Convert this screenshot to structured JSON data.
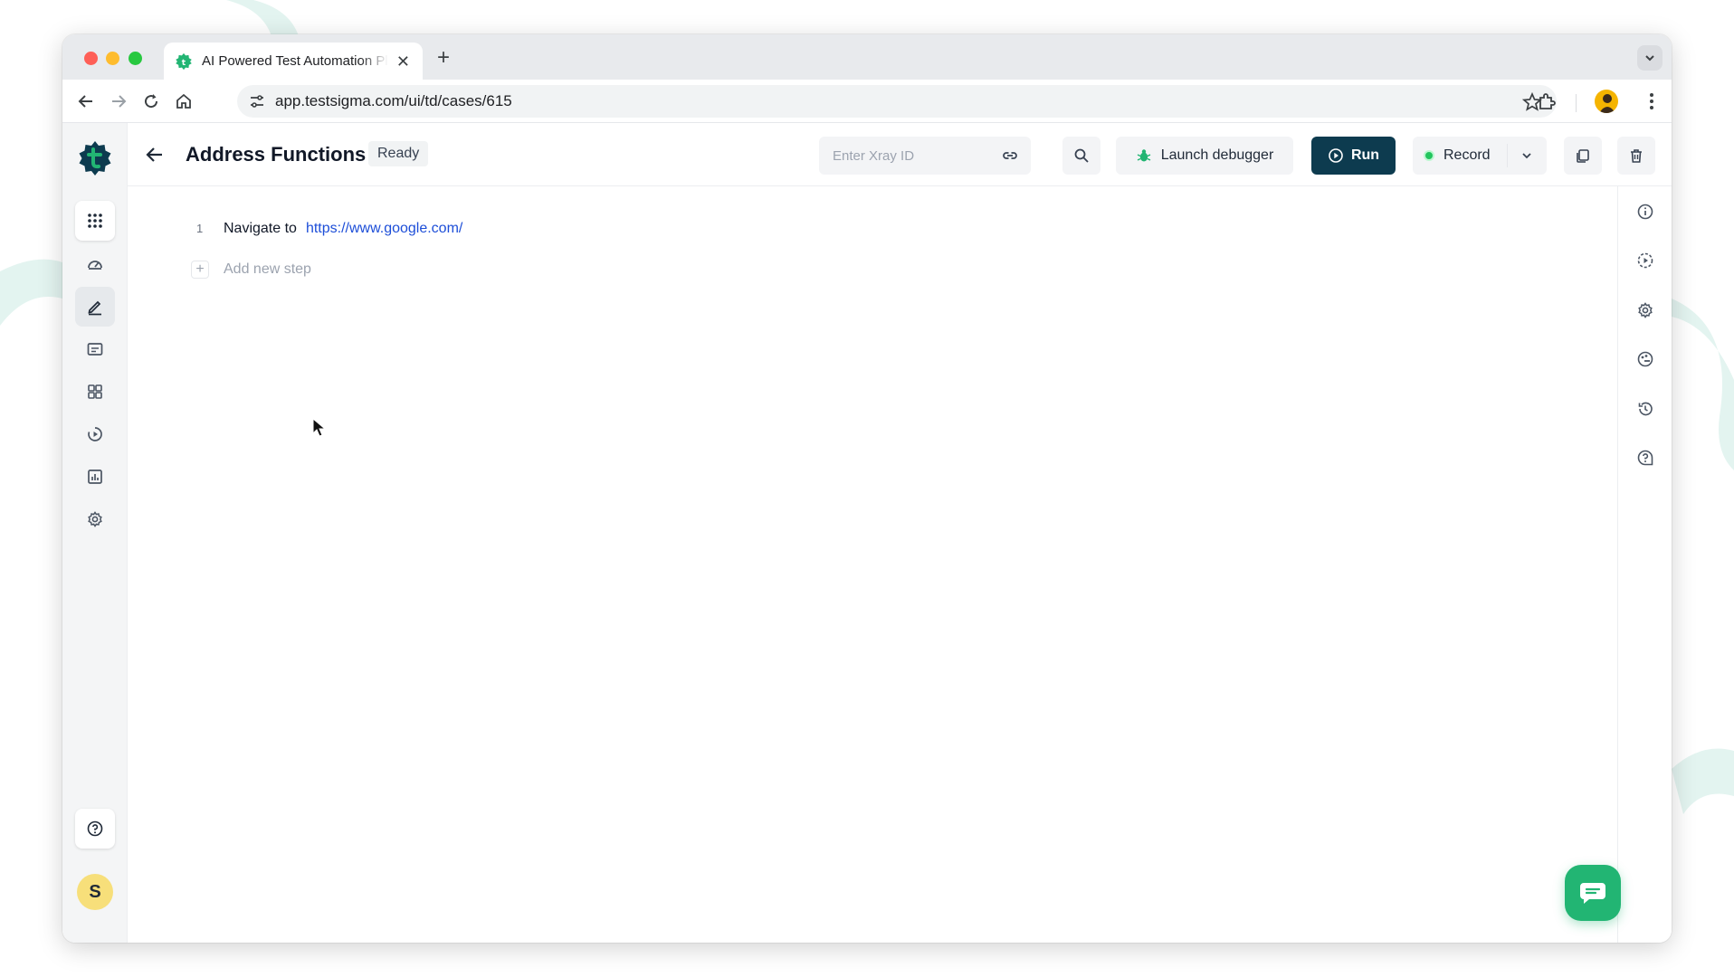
{
  "browser": {
    "tab_title": "AI Powered Test Automation Platform",
    "tab_close": "✕",
    "new_tab": "+",
    "url": "app.testsigma.com/ui/td/cases/615"
  },
  "header": {
    "title": "Address Functions",
    "status": "Ready",
    "xray_placeholder": "Enter Xray ID",
    "launch_debugger": "Launch debugger",
    "run": "Run",
    "record": "Record"
  },
  "steps": [
    {
      "number": "1",
      "action": "Navigate to",
      "target": "https://www.google.com/"
    }
  ],
  "add_step": {
    "plus": "+",
    "label": "Add new step"
  },
  "user": {
    "initial": "S"
  },
  "colors": {
    "run_button": "#0d3b4f",
    "brand_green": "#22b573",
    "link": "#1d4ed8",
    "avatar": "#f7df7a"
  },
  "icons": {
    "left_rail": [
      "apps-grid-icon",
      "dashboard-gauge-icon",
      "edit-pencil-icon",
      "folder-list-icon",
      "modules-grid-icon",
      "play-circle-icon",
      "reports-chart-icon",
      "settings-gear-icon",
      "help-icon"
    ],
    "right_rail": [
      "info-icon",
      "play-dashed-icon",
      "settings-gear-icon",
      "palette-icon",
      "history-icon",
      "help-icon"
    ]
  }
}
